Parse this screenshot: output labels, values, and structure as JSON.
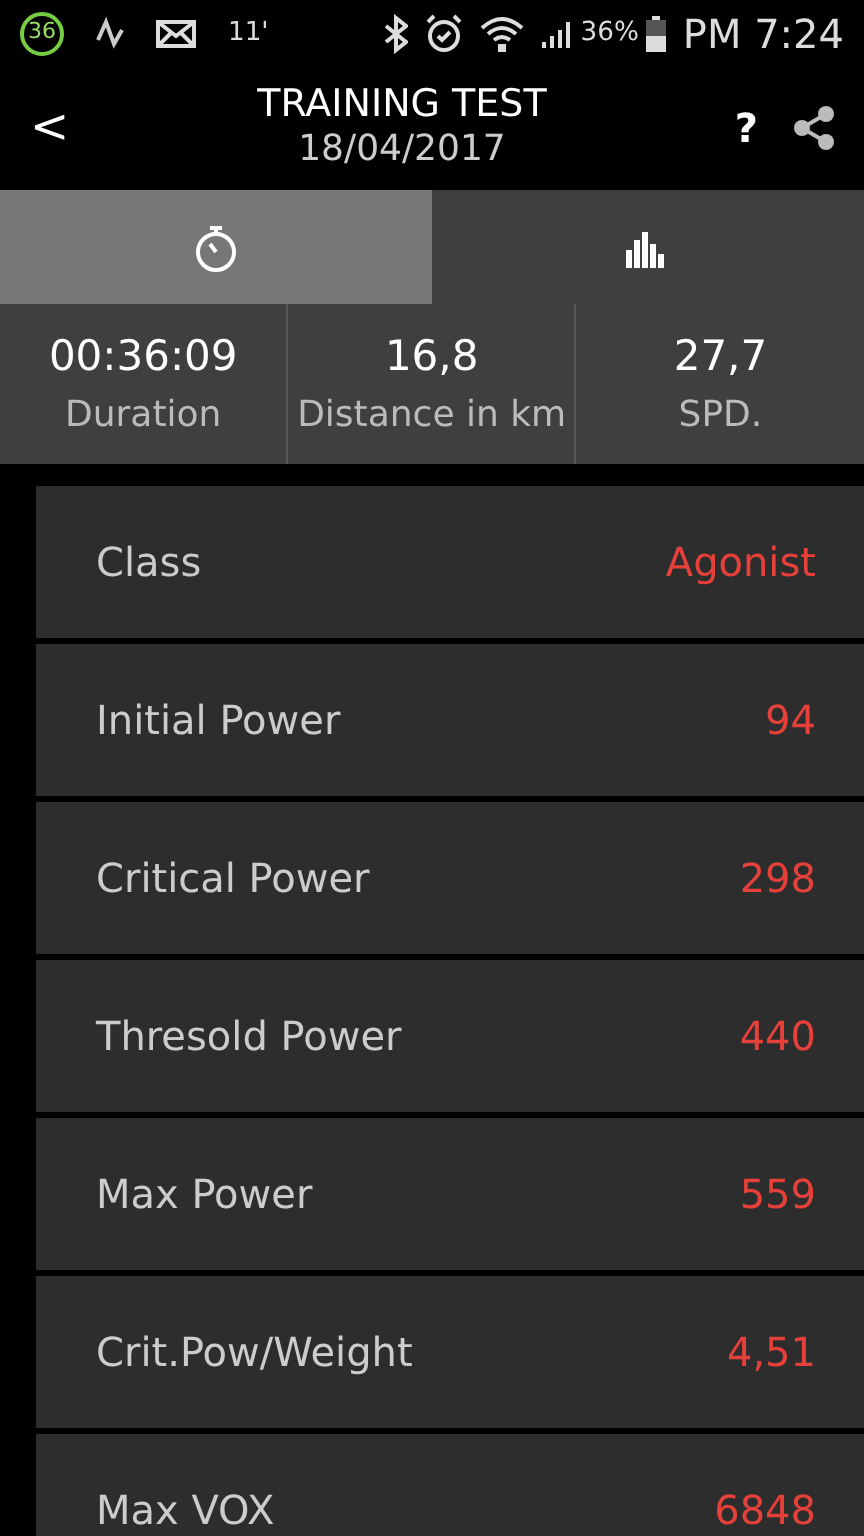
{
  "status_bar": {
    "badge": "36",
    "temperature": "11'",
    "battery": "36%",
    "time": "PM 7:24"
  },
  "header": {
    "back": "<",
    "title": "TRAINING TEST",
    "subtitle": "18/04/2017",
    "help": "?"
  },
  "tabs": [
    {
      "kind": "stopwatch",
      "selected": true
    },
    {
      "kind": "bars",
      "selected": false
    }
  ],
  "stats": [
    {
      "value": "00:36:09",
      "label": "Duration"
    },
    {
      "value": "16,8",
      "label": "Distance in km"
    },
    {
      "value": "27,7",
      "label": "SPD."
    }
  ],
  "rows": [
    {
      "label": "Class",
      "value": "Agonist"
    },
    {
      "label": "Initial Power",
      "value": "94"
    },
    {
      "label": "Critical Power",
      "value": "298"
    },
    {
      "label": "Thresold Power",
      "value": "440"
    },
    {
      "label": "Max Power",
      "value": "559"
    },
    {
      "label": "Crit.Pow/Weight",
      "value": "4,51"
    },
    {
      "label": "Max VOX",
      "value": "6848"
    }
  ]
}
